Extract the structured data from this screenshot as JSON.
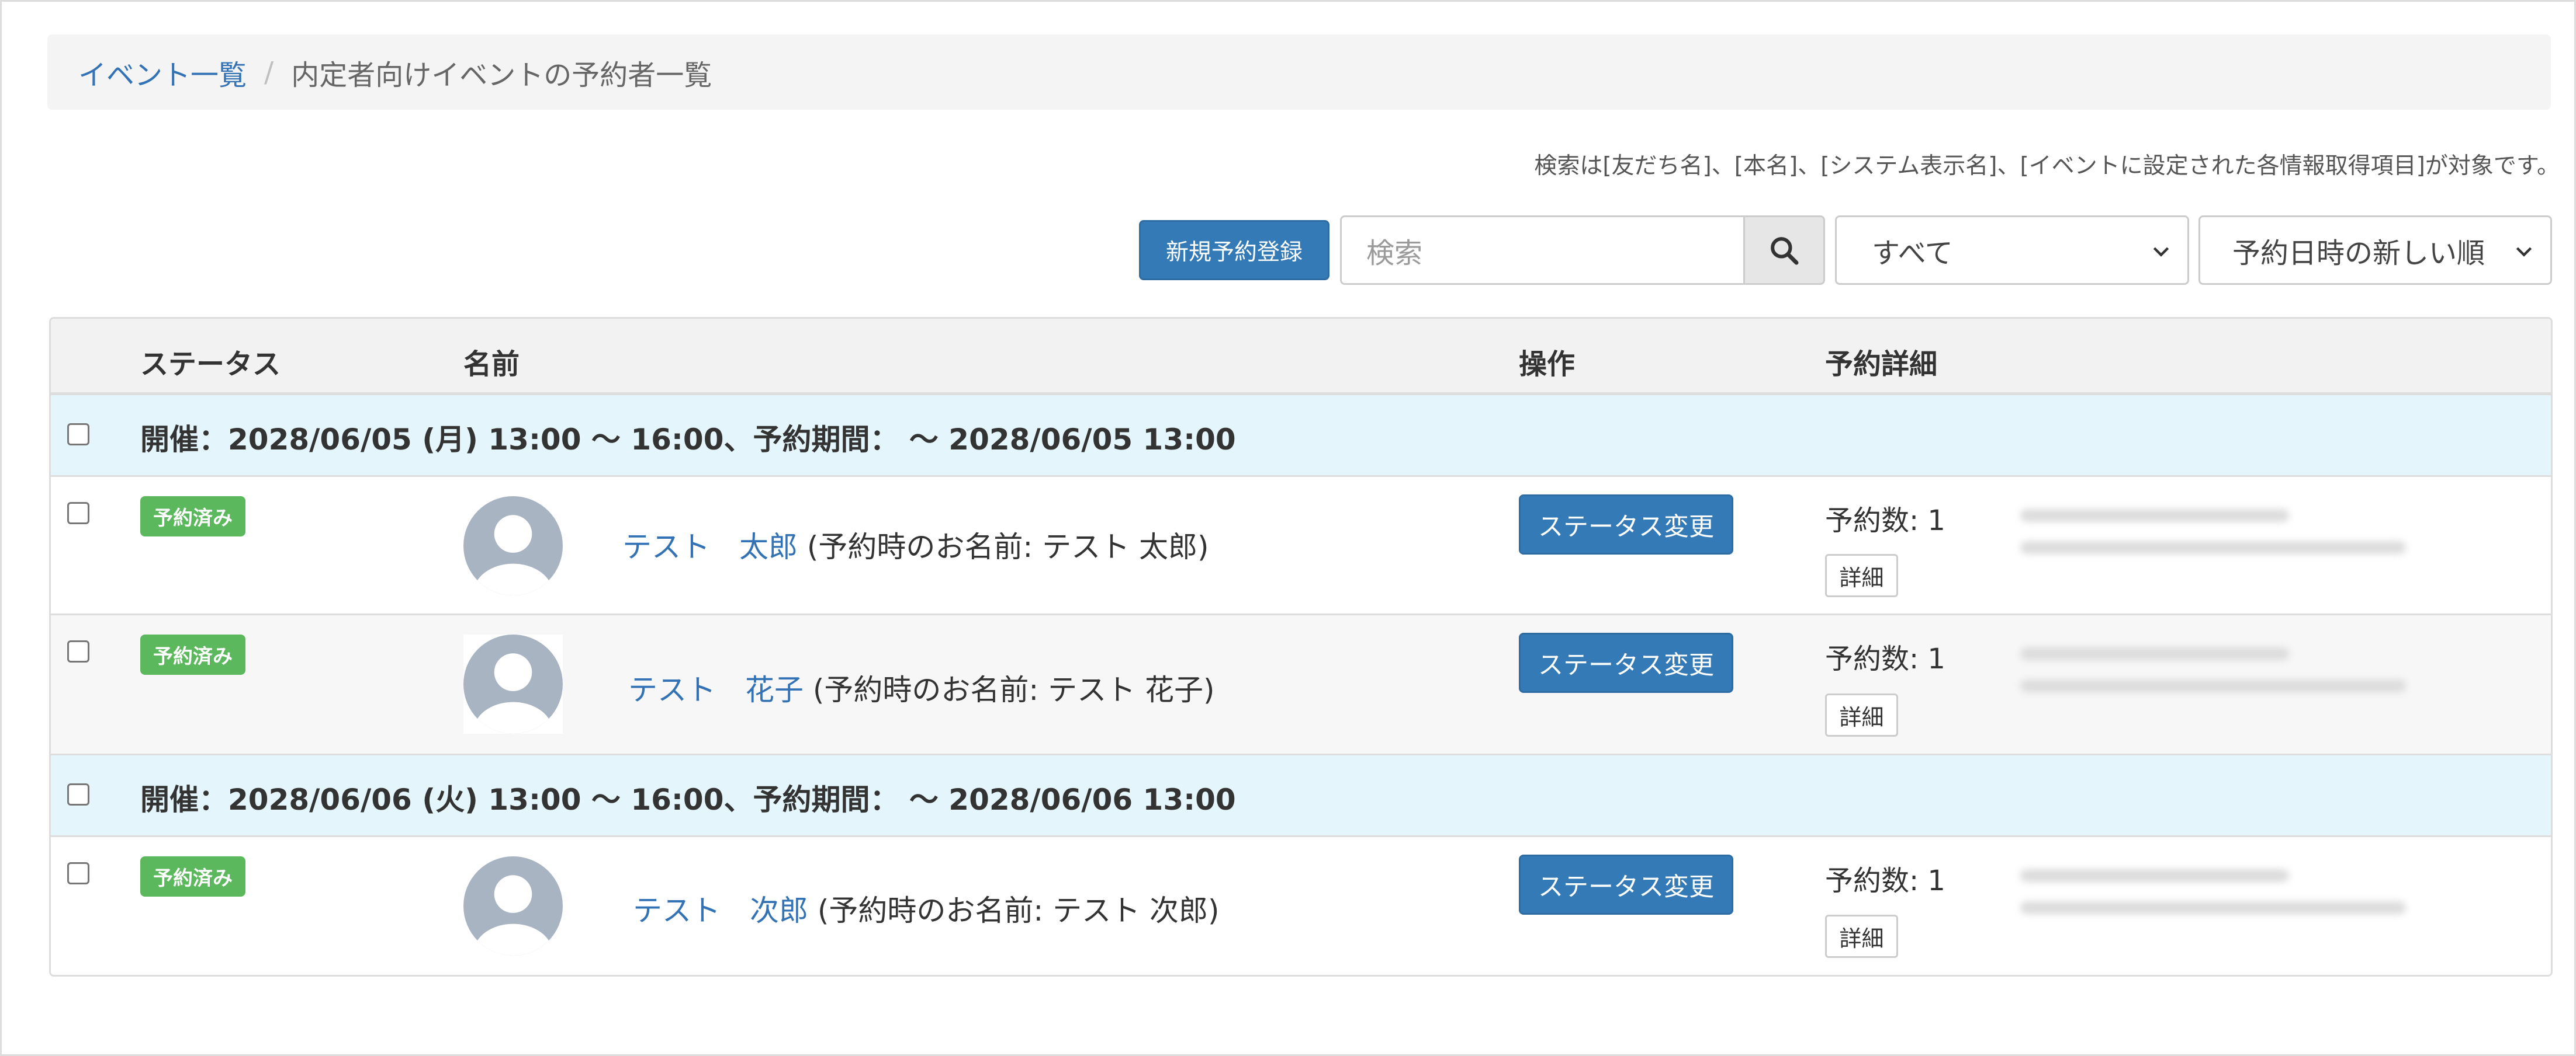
{
  "breadcrumb": {
    "link_label": "イベント一覧",
    "separator": "/",
    "current_label": "内定者向けイベントの予約者一覧"
  },
  "search_note": "検索は[友だち名]、[本名]、[システム表示名]、[イベントに設定された各情報取得項目]が対象です。",
  "toolbar": {
    "new_button_label": "新規予約登録",
    "search_placeholder": "検索",
    "search_icon": "search-icon",
    "filter_select_value": "すべて",
    "sort_select_value": "予約日時の新しい順"
  },
  "table": {
    "headers": {
      "status": "ステータス",
      "name": "名前",
      "operation": "操作",
      "details": "予約詳細"
    },
    "groups": [
      {
        "label": "開催：2028/06/05 (月) 13:00 ～ 16:00、予約期間： ～ 2028/06/05 13:00",
        "rows": [
          {
            "status_badge": "予約済み",
            "name": "テスト　太郎",
            "name_note": "(予約時のお名前: テスト 太郎)",
            "action_label": "ステータス変更",
            "reservation_count": "予約数: 1",
            "detail_label": "詳細"
          },
          {
            "status_badge": "予約済み",
            "name": "テスト　花子",
            "name_note": "(予約時のお名前: テスト 花子)",
            "action_label": "ステータス変更",
            "reservation_count": "予約数: 1",
            "detail_label": "詳細"
          }
        ]
      },
      {
        "label": "開催：2028/06/06 (火) 13:00 ～ 16:00、予約期間： ～ 2028/06/06 13:00",
        "rows": [
          {
            "status_badge": "予約済み",
            "name": "テスト　次郎",
            "name_note": "(予約時のお名前: テスト 次郎)",
            "action_label": "ステータス変更",
            "reservation_count": "予約数: 1",
            "detail_label": "詳細"
          }
        ]
      }
    ]
  },
  "colors": {
    "primary": "#337ab7",
    "badge_success": "#5cb85c",
    "link": "#3373b5",
    "group_row_bg": "#e4f6fb"
  }
}
